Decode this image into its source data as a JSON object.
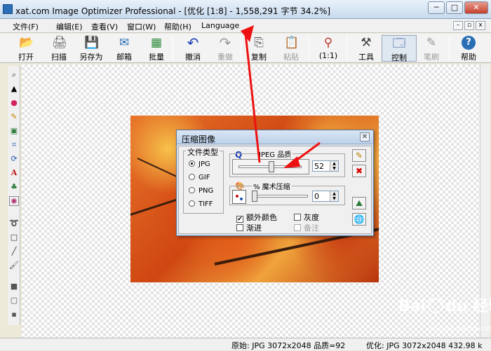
{
  "titlebar": {
    "title": "xat.com  Image Optimizer Professional - [优化 [1:8] - 1,558,291 字节 34.2%]",
    "minimize_glyph": "─",
    "maximize_glyph": "□",
    "close_glyph": "✕"
  },
  "menu": {
    "items": [
      "文件(F)",
      "编辑(E)",
      "查看(V)",
      "窗口(W)",
      "帮助(H)",
      "Language"
    ],
    "mdi_minimize": "–",
    "mdi_restore": "▫",
    "mdi_close": "x"
  },
  "toolbar": {
    "buttons": [
      {
        "label": "打开",
        "icon": "open-folder-icon",
        "glyph": "📂",
        "enabled": true
      },
      {
        "label": "扫描",
        "icon": "scan-icon",
        "glyph": "🖨",
        "enabled": true
      },
      {
        "label": "另存为",
        "icon": "save-icon",
        "glyph": "💾",
        "enabled": true
      },
      {
        "label": "邮箱",
        "icon": "mail-icon",
        "glyph": "✉",
        "enabled": true
      },
      {
        "label": "批量",
        "icon": "batch-icon",
        "glyph": "▦",
        "enabled": true
      },
      {
        "label": "撤消",
        "icon": "undo-icon",
        "glyph": "↶",
        "enabled": true
      },
      {
        "label": "重做",
        "icon": "redo-icon",
        "glyph": "↷",
        "enabled": false
      },
      {
        "label": "复制",
        "icon": "copy-icon",
        "glyph": "⎘",
        "enabled": true
      },
      {
        "label": "粘贴",
        "icon": "paste-icon",
        "glyph": "📋",
        "enabled": false
      },
      {
        "label": "(1:1)",
        "icon": "actual-size-icon",
        "glyph": "⚲",
        "enabled": true
      },
      {
        "label": "工具",
        "icon": "tools-icon",
        "glyph": "⚒",
        "enabled": true
      },
      {
        "label": "控制",
        "icon": "control-icon",
        "glyph": "🗔",
        "enabled": true
      },
      {
        "label": "笔刷",
        "icon": "brush-icon",
        "glyph": "✎",
        "enabled": false
      },
      {
        "label": "帮助",
        "icon": "help-icon",
        "glyph": "?",
        "enabled": true
      }
    ]
  },
  "toolbox": {
    "tools": [
      {
        "icon": "zoom-tool-icon",
        "glyph": "⌕"
      },
      {
        "icon": "fill-tool-icon",
        "glyph": "▲"
      },
      {
        "icon": "color-tool-icon",
        "glyph": "●"
      },
      {
        "icon": "pencil-tool-icon",
        "glyph": "✎"
      },
      {
        "icon": "image-tool-icon",
        "glyph": "▣"
      },
      {
        "icon": "crop-tool-icon",
        "glyph": "⌗"
      },
      {
        "icon": "rotate-tool-icon",
        "glyph": "⟳"
      },
      {
        "icon": "text-tool-icon",
        "glyph": "A"
      },
      {
        "icon": "stamp-tool-icon",
        "glyph": "♣"
      },
      {
        "icon": "effect-tool-icon",
        "glyph": "✺"
      },
      {
        "icon": "lasso-tool-icon",
        "glyph": "➰"
      },
      {
        "icon": "rectangle-tool-icon",
        "glyph": "□"
      },
      {
        "icon": "line-tool-icon",
        "glyph": "╱"
      },
      {
        "icon": "brush-tool-icon",
        "glyph": "🖌"
      },
      {
        "icon": "fill-square-icon",
        "glyph": "■"
      },
      {
        "icon": "frame-square-icon",
        "glyph": "▢"
      },
      {
        "icon": "small-square-icon",
        "glyph": "▪"
      }
    ]
  },
  "dialog": {
    "title": "压缩图像",
    "close_glyph": "✕",
    "file_type": {
      "label": "文件类型",
      "options": [
        "JPG",
        "GIF",
        "PNG",
        "TIFF"
      ],
      "selected": "JPG"
    },
    "jpeg_quality": {
      "icon_glyph": "Q",
      "label": "JPEG 品质",
      "value": "52",
      "level": 0.52
    },
    "magic_compress": {
      "icon_glyph": "🎨",
      "label": "% 魔术压缩",
      "value": "0",
      "level": 0
    },
    "checkboxes": [
      {
        "label": "额外颜色",
        "checked": true,
        "enabled": true
      },
      {
        "label": "灰度",
        "checked": false,
        "enabled": true
      },
      {
        "label": "渐进",
        "checked": false,
        "enabled": true
      },
      {
        "label": "备注",
        "checked": false,
        "enabled": false
      }
    ],
    "side_buttons": [
      {
        "icon": "pen-icon",
        "glyph": "✎"
      },
      {
        "icon": "red-x-icon",
        "glyph": "✖",
        "color": "#d40000"
      },
      {
        "icon": "landscape-icon",
        "glyph": "⛰"
      },
      {
        "icon": "globe-icon",
        "glyph": "🌐"
      }
    ]
  },
  "statusbar": {
    "original": "原始: JPG 3072x2048  品质=92",
    "optimized": "优化: JPG 3072x2048  432.98 k"
  },
  "watermark": {
    "text_a": "Bai",
    "text_b": "du",
    "text_c": "经验",
    "url": "jingyan.baidu.com"
  },
  "colors": {
    "annotation_arrow": "#ee1111",
    "close_x_red": "#d40000",
    "brand_blue": "#1a3bb5"
  }
}
